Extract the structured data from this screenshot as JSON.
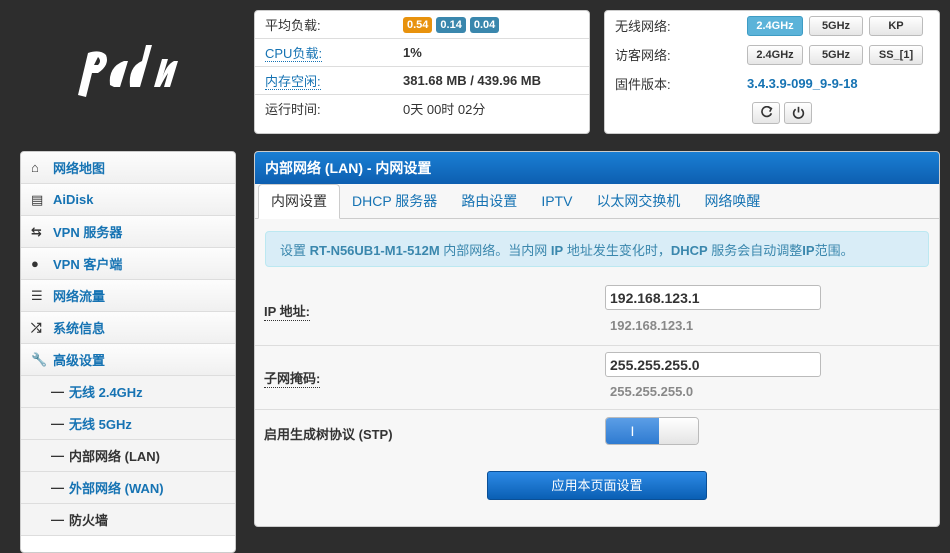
{
  "brand": {
    "logo_text": "padavan"
  },
  "system": {
    "load_label": "平均负载:",
    "load_values": [
      "0.54",
      "0.14",
      "0.04"
    ],
    "cpu_label": "CPU负载:",
    "cpu_value": "1%",
    "mem_label": "内存空闲:",
    "mem_value": "381.68 MB / 439.96 MB",
    "uptime_label": "运行时间:",
    "uptime_value": "0天 00时 02分"
  },
  "network": {
    "wireless_label": "无线网络:",
    "wireless_buttons": [
      "2.4GHz",
      "5GHz",
      "KP"
    ],
    "guest_label": "访客网络:",
    "guest_buttons": [
      "2.4GHz",
      "5GHz",
      "SS_[1]"
    ],
    "firmware_label": "固件版本:",
    "firmware_value": "3.4.3.9-099_9-9-18"
  },
  "sidebar": {
    "items": [
      {
        "label": "网络地图",
        "icon": "home-icon"
      },
      {
        "label": "AiDisk",
        "icon": "hdd-icon"
      },
      {
        "label": "VPN 服务器",
        "icon": "retweet-icon"
      },
      {
        "label": "VPN 客户端",
        "icon": "globe-icon"
      },
      {
        "label": "网络流量",
        "icon": "tasks-icon"
      },
      {
        "label": "系统信息",
        "icon": "random-icon"
      },
      {
        "label": "高级设置",
        "icon": "wrench-icon"
      }
    ],
    "sub_items": [
      {
        "label": "无线 2.4GHz"
      },
      {
        "label": "无线 5GHz"
      },
      {
        "label": "内部网络 (LAN)"
      },
      {
        "label": "外部网络 (WAN)"
      },
      {
        "label": "防火墙"
      }
    ]
  },
  "main": {
    "title": "内部网络 (LAN) - 内网设置",
    "tabs": [
      "内网设置",
      "DHCP 服务器",
      "路由设置",
      "IPTV",
      "以太网交换机",
      "网络唤醒"
    ],
    "info_prefix": "设置 ",
    "info_device": "RT-N56UB1-M1-512M",
    "info_mid1": " 内部网络。当内网 ",
    "info_ip": "IP",
    "info_mid2": " 地址发生变化时，",
    "info_dhcp": "DHCP",
    "info_mid3": " 服务会自动调整",
    "info_ip2": "IP",
    "info_suffix": "范围。",
    "ip_label": "IP 地址:",
    "ip_value": "192.168.123.1",
    "ip_hint": "192.168.123.1",
    "mask_label": "子网掩码:",
    "mask_value": "255.255.255.0",
    "mask_hint": "255.255.255.0",
    "stp_label": "启用生成树协议 (STP)",
    "stp_on_text": "I",
    "apply_label": "应用本页面设置"
  }
}
